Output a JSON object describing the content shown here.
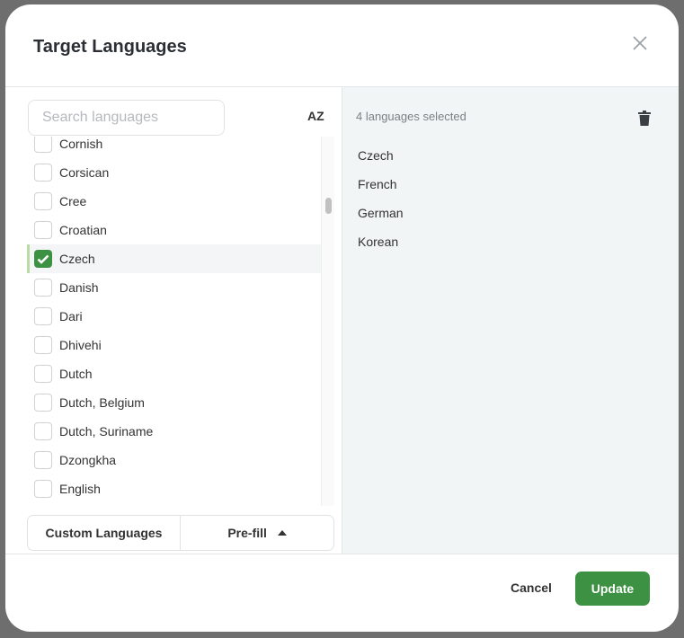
{
  "dialog": {
    "title": "Target Languages"
  },
  "search": {
    "placeholder": "Search languages",
    "value": ""
  },
  "languages": [
    {
      "label": "Cornish",
      "checked": false
    },
    {
      "label": "Corsican",
      "checked": false
    },
    {
      "label": "Cree",
      "checked": false
    },
    {
      "label": "Croatian",
      "checked": false
    },
    {
      "label": "Czech",
      "checked": true
    },
    {
      "label": "Danish",
      "checked": false
    },
    {
      "label": "Dari",
      "checked": false
    },
    {
      "label": "Dhivehi",
      "checked": false
    },
    {
      "label": "Dutch",
      "checked": false
    },
    {
      "label": "Dutch, Belgium",
      "checked": false
    },
    {
      "label": "Dutch, Suriname",
      "checked": false
    },
    {
      "label": "Dzongkha",
      "checked": false
    },
    {
      "label": "English",
      "checked": false
    }
  ],
  "buttons": {
    "custom": "Custom Languages",
    "prefill": "Pre-fill",
    "prefill_icon": "caret-up-icon",
    "sort_icon": "sort-alpha-icon",
    "sort_label": "AZ",
    "cancel": "Cancel",
    "update": "Update"
  },
  "selected": {
    "count_label": "4 languages selected",
    "items": [
      "Czech",
      "French",
      "German",
      "Korean"
    ]
  },
  "colors": {
    "accent": "#3d9142",
    "panel": "#f1f5f6"
  }
}
